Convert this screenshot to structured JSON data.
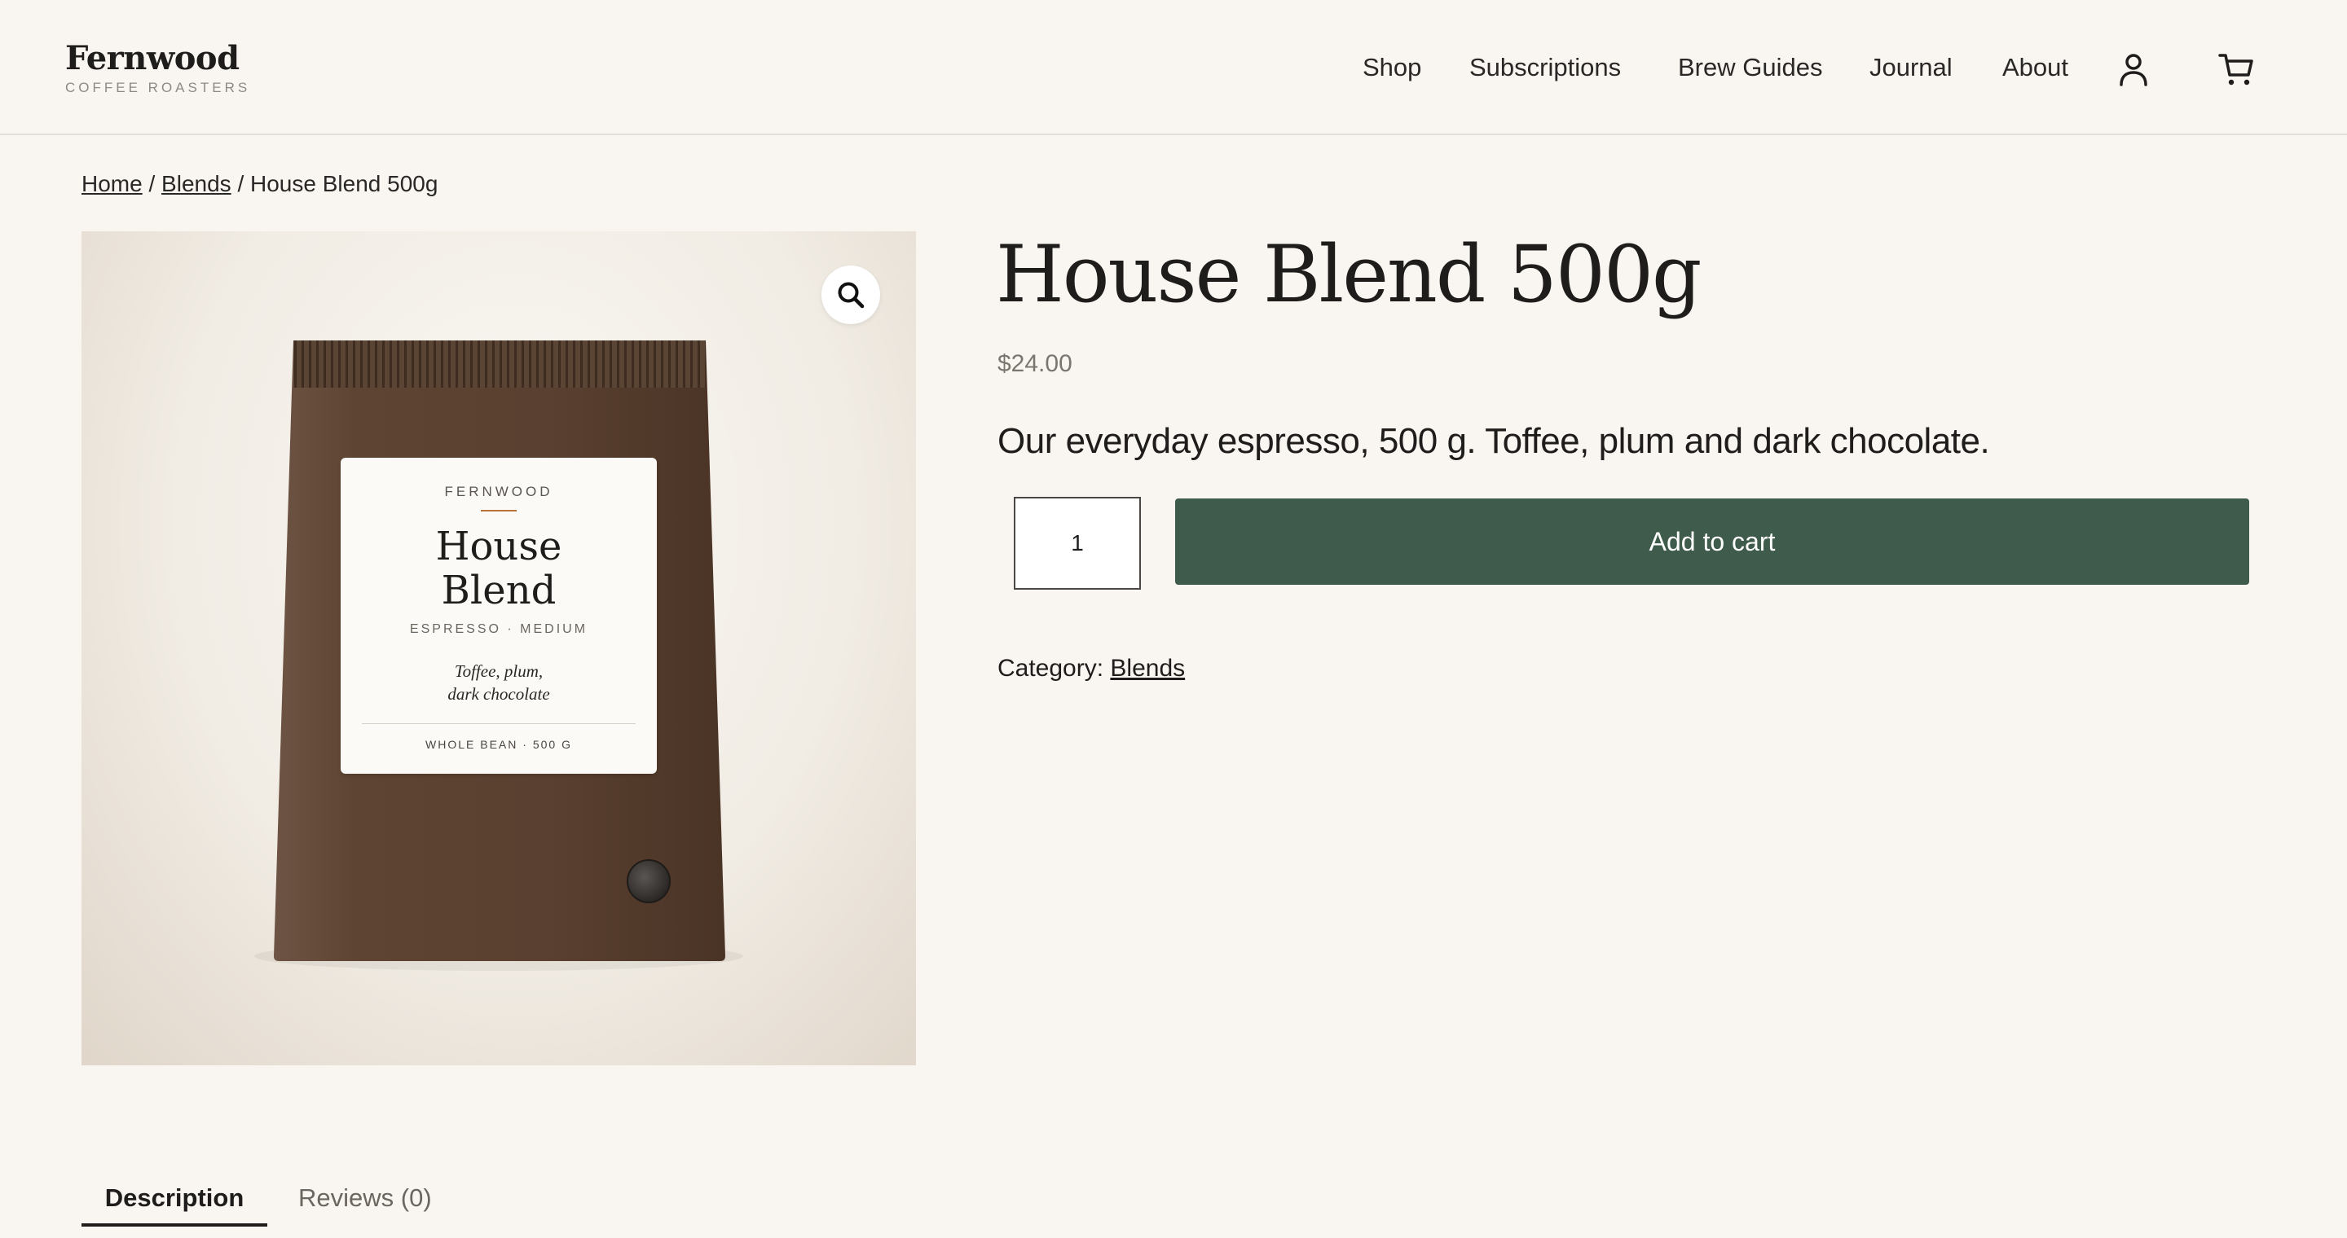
{
  "brand": {
    "name": "Fernwood",
    "tagline": "COFFEE ROASTERS"
  },
  "nav": {
    "items": [
      "Shop",
      "Subscriptions",
      "Brew Guides",
      "Journal",
      "About"
    ],
    "account_icon": "user-icon",
    "cart_icon": "cart-icon"
  },
  "breadcrumb": {
    "home": "Home",
    "sep1": "/",
    "category": "Blends",
    "sep2": "/",
    "current": "House Blend 500g"
  },
  "product": {
    "title": "House Blend 500g",
    "price": "$24.00",
    "short_description": "Our everyday espresso, 500 g. Toffee, plum and dark chocolate.",
    "quantity": "1",
    "add_to_cart_label": "Add to cart",
    "category_label": "Category:",
    "category": "Blends",
    "zoom_icon": "search-icon"
  },
  "bag_label": {
    "brand": "FERNWOOD",
    "name_line1": "House",
    "name_line2": "Blend",
    "type": "ESPRESSO · MEDIUM",
    "notes_line1": "Toffee, plum,",
    "notes_line2": "dark chocolate",
    "footer": "WHOLE BEAN · 500 G"
  },
  "tabs": {
    "description": "Description",
    "reviews": "Reviews (0)"
  },
  "colors": {
    "accent": "#3f5b4b",
    "background": "#f9f6f1",
    "bag": "#5a4030"
  }
}
